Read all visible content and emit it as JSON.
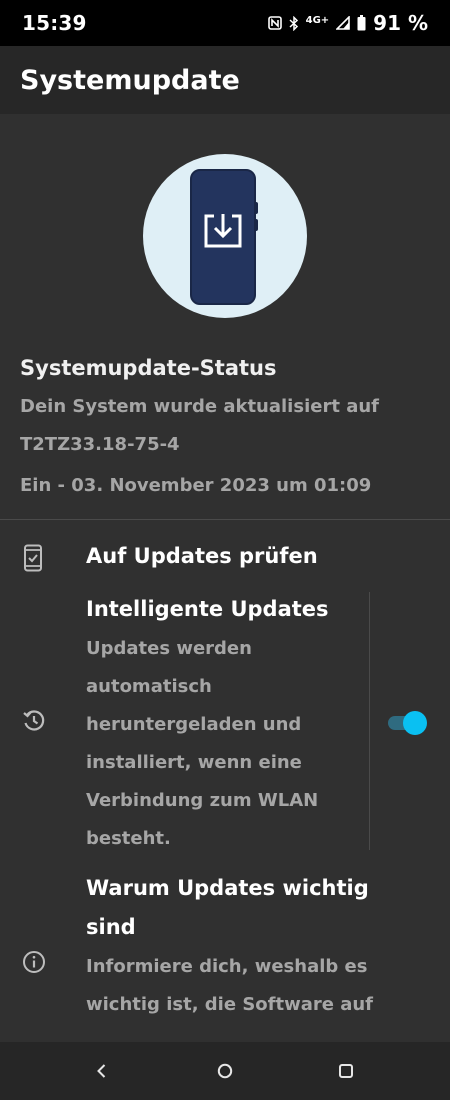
{
  "status_bar": {
    "time": "15:39",
    "network": "4G+",
    "battery_percent": "91 %",
    "icons": [
      "nfc-icon",
      "bluetooth-icon",
      "signal-icon",
      "battery-icon"
    ]
  },
  "app_bar": {
    "title": "Systemupdate"
  },
  "illustration": {
    "icon": "phone-download-icon",
    "colors": {
      "circle": "#dfeff6",
      "phone": "#23345e"
    }
  },
  "update_status": {
    "title": "Systemupdate-Status",
    "lines": [
      "Dein System wurde aktualisiert auf",
      "T2TZ33.18-75-4",
      "Ein - 03. November 2023 um 01:09"
    ]
  },
  "settings": {
    "check_updates": {
      "icon": "phone-check-icon",
      "label": "Auf Updates prüfen"
    },
    "smart_updates": {
      "icon": "history-icon",
      "title": "Intelligente Updates",
      "description_lines": [
        "Updates werden",
        "automatisch",
        "heruntergeladen und",
        "installiert, wenn eine",
        "Verbindung zum WLAN",
        "besteht."
      ],
      "toggle_on": true,
      "accent_color": "#0ac0f2"
    },
    "why_updates": {
      "icon": "info-icon",
      "title_lines": [
        "Warum Updates wichtig",
        "sind"
      ],
      "description_lines": [
        "Informiere dich, weshalb es",
        "wichtig ist, die Software auf"
      ]
    }
  },
  "nav_bar": {
    "buttons": [
      "back-icon",
      "home-icon",
      "recents-icon"
    ]
  }
}
